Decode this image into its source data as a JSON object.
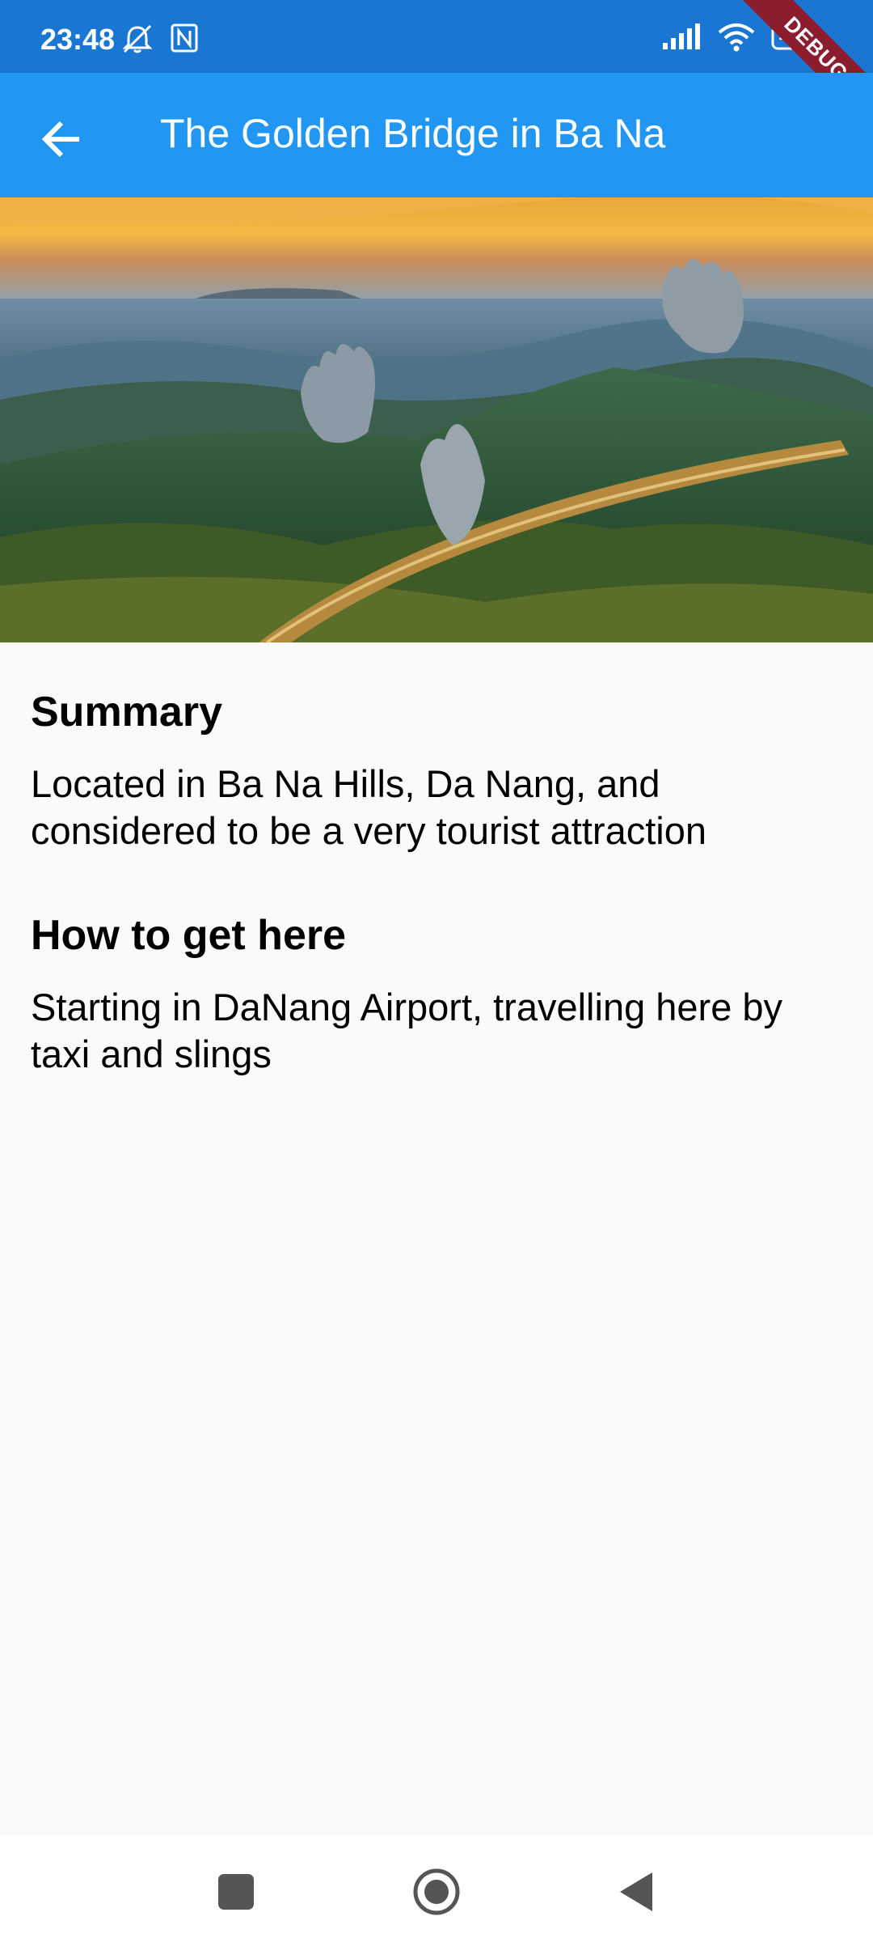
{
  "status_bar": {
    "time": "23:48",
    "battery": "46",
    "debug_label": "DEBUG",
    "icons": [
      "mute-icon",
      "nfc-icon",
      "signal-icon",
      "wifi-icon",
      "battery-icon"
    ]
  },
  "app_bar": {
    "title": "The Golden Bridge in Ba Na",
    "back_icon": "arrow-back-icon"
  },
  "hero": {
    "image": "golden-bridge-photo"
  },
  "sections": [
    {
      "heading": "Summary",
      "text": "Located in Ba Na Hills, Da Nang, and considered to be a very tourist attraction"
    },
    {
      "heading": "How to get here",
      "text": "Starting in DaNang Airport, travelling here by taxi and slings"
    }
  ],
  "nav_bar": {
    "buttons": [
      "recents-button",
      "home-button",
      "back-button"
    ]
  },
  "colors": {
    "status_bar": "#1976d2",
    "app_bar": "#2196f3",
    "background": "#fafafa"
  }
}
